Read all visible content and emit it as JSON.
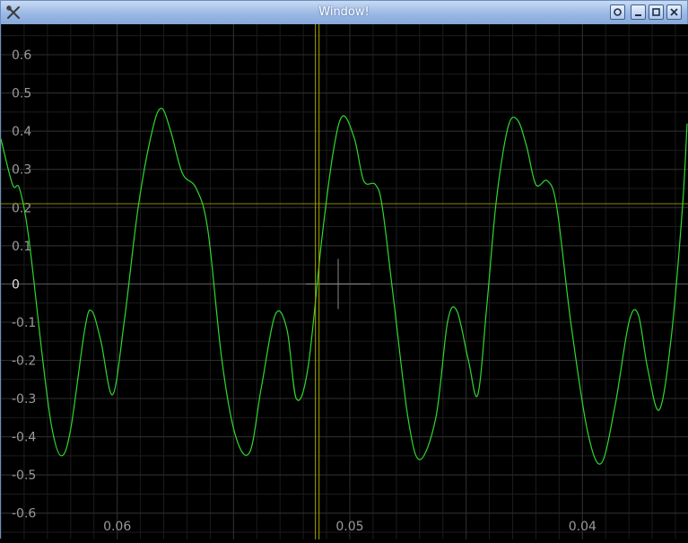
{
  "window": {
    "title": "Window!",
    "icons": {
      "app": "wrench-scissors-icon",
      "settings": "circle-icon",
      "minimize": "minimize-icon",
      "maximize": "maximize-icon",
      "close": "close-icon"
    }
  },
  "chart_data": {
    "type": "line",
    "title": "",
    "xlabel": "",
    "ylabel": "",
    "xlim": [
      0.065,
      0.0355
    ],
    "ylim": [
      -0.65,
      0.68
    ],
    "x_reversed": true,
    "y_ticks": [
      {
        "value": 0.6,
        "label": "0.6"
      },
      {
        "value": 0.5,
        "label": "0.5"
      },
      {
        "value": 0.4,
        "label": "0.4"
      },
      {
        "value": 0.3,
        "label": "0.3"
      },
      {
        "value": 0.2,
        "label": "0.2"
      },
      {
        "value": 0.1,
        "label": "0.1"
      },
      {
        "value": 0,
        "label": "0"
      },
      {
        "value": -0.1,
        "label": "-0.1"
      },
      {
        "value": -0.2,
        "label": "-0.2"
      },
      {
        "value": -0.3,
        "label": "-0.3"
      },
      {
        "value": -0.4,
        "label": "-0.4"
      },
      {
        "value": -0.5,
        "label": "-0.5"
      },
      {
        "value": -0.6,
        "label": "-0.6"
      }
    ],
    "x_ticks": [
      {
        "value": 0.06,
        "label": "0.06"
      },
      {
        "value": 0.05,
        "label": "0.05"
      },
      {
        "value": 0.04,
        "label": "0.04"
      }
    ],
    "grid": true,
    "cursor": {
      "x": 0.0514,
      "y": 0.21
    },
    "colors": {
      "background": "#000000",
      "grid_minor": "#1c1c1c",
      "grid_major": "#2e2e2e",
      "zero_line": "#5a5a5a",
      "signal": "#2fd82f",
      "cursor": "#a8a800",
      "tick_label": "#9a9a9a",
      "zero_label": "#e0e0e0"
    },
    "series": [
      {
        "values": [
          [
            0.065,
            0.38
          ],
          [
            0.0645,
            0.26
          ],
          [
            0.0642,
            0.25
          ],
          [
            0.0638,
            0.12
          ],
          [
            0.0632,
            -0.2
          ],
          [
            0.0628,
            -0.38
          ],
          [
            0.0624,
            -0.45
          ],
          [
            0.062,
            -0.38
          ],
          [
            0.0614,
            -0.12
          ],
          [
            0.0611,
            -0.07
          ],
          [
            0.0607,
            -0.15
          ],
          [
            0.0602,
            -0.29
          ],
          [
            0.0597,
            -0.1
          ],
          [
            0.0591,
            0.2
          ],
          [
            0.0585,
            0.4
          ],
          [
            0.0581,
            0.46
          ],
          [
            0.0577,
            0.4
          ],
          [
            0.0572,
            0.29
          ],
          [
            0.0566,
            0.25
          ],
          [
            0.0561,
            0.14
          ],
          [
            0.0555,
            -0.2
          ],
          [
            0.0549,
            -0.4
          ],
          [
            0.0543,
            -0.44
          ],
          [
            0.0538,
            -0.27
          ],
          [
            0.0532,
            -0.08
          ],
          [
            0.0527,
            -0.12
          ],
          [
            0.0523,
            -0.3
          ],
          [
            0.0518,
            -0.22
          ],
          [
            0.0512,
            0.12
          ],
          [
            0.0507,
            0.35
          ],
          [
            0.0503,
            0.44
          ],
          [
            0.0498,
            0.38
          ],
          [
            0.0494,
            0.27
          ],
          [
            0.0489,
            0.26
          ],
          [
            0.0486,
            0.2
          ],
          [
            0.0481,
            -0.05
          ],
          [
            0.0475,
            -0.35
          ],
          [
            0.047,
            -0.46
          ],
          [
            0.0463,
            -0.35
          ],
          [
            0.0458,
            -0.1
          ],
          [
            0.0454,
            -0.07
          ],
          [
            0.0449,
            -0.2
          ],
          [
            0.0445,
            -0.29
          ],
          [
            0.0441,
            -0.05
          ],
          [
            0.0437,
            0.22
          ],
          [
            0.0432,
            0.41
          ],
          [
            0.0428,
            0.43
          ],
          [
            0.0424,
            0.36
          ],
          [
            0.042,
            0.26
          ],
          [
            0.0415,
            0.27
          ],
          [
            0.0411,
            0.2
          ],
          [
            0.0405,
            -0.1
          ],
          [
            0.0398,
            -0.38
          ],
          [
            0.0392,
            -0.47
          ],
          [
            0.0386,
            -0.32
          ],
          [
            0.038,
            -0.1
          ],
          [
            0.0376,
            -0.08
          ],
          [
            0.0372,
            -0.22
          ],
          [
            0.0367,
            -0.33
          ],
          [
            0.0362,
            -0.15
          ],
          [
            0.0357,
            0.2
          ],
          [
            0.0355,
            0.42
          ]
        ]
      }
    ]
  }
}
